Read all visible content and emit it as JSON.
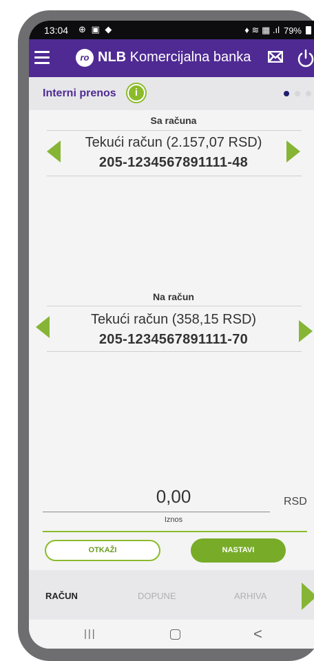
{
  "status_bar": {
    "time": "13:04",
    "left_icons": "⊕ ▣ ◆",
    "right_icons": "♦ ≋ ▦ .ıl",
    "battery": "79%"
  },
  "app_bar": {
    "logo_mark": "ro",
    "brand_bold": "NLB",
    "brand_rest": " Komercijalna banka"
  },
  "page": {
    "title": "Interni prenos",
    "info_icon": "i",
    "step_dots": 3,
    "active_step": 1
  },
  "from_account": {
    "label": "Sa računa",
    "name": "Tekući račun (2.157,07 RSD)",
    "number": "205-1234567891111-48"
  },
  "to_account": {
    "label": "Na račun",
    "name": "Tekući račun (358,15 RSD)",
    "number": "205-1234567891111-70"
  },
  "amount": {
    "value": "0,00",
    "currency": "RSD",
    "label": "Iznos"
  },
  "buttons": {
    "cancel": "OTKAŽI",
    "next": "NASTAVI"
  },
  "tabs": [
    {
      "label": "RAČUN",
      "active": true
    },
    {
      "label": "DOPUNE",
      "active": false
    },
    {
      "label": "ARHIVA",
      "active": false
    }
  ],
  "nav": {
    "recent": "|||",
    "back": "<"
  },
  "colors": {
    "brand_purple": "#4f2a93",
    "accent_green": "#8bbb2b",
    "dot_active": "#1f1f6b"
  }
}
